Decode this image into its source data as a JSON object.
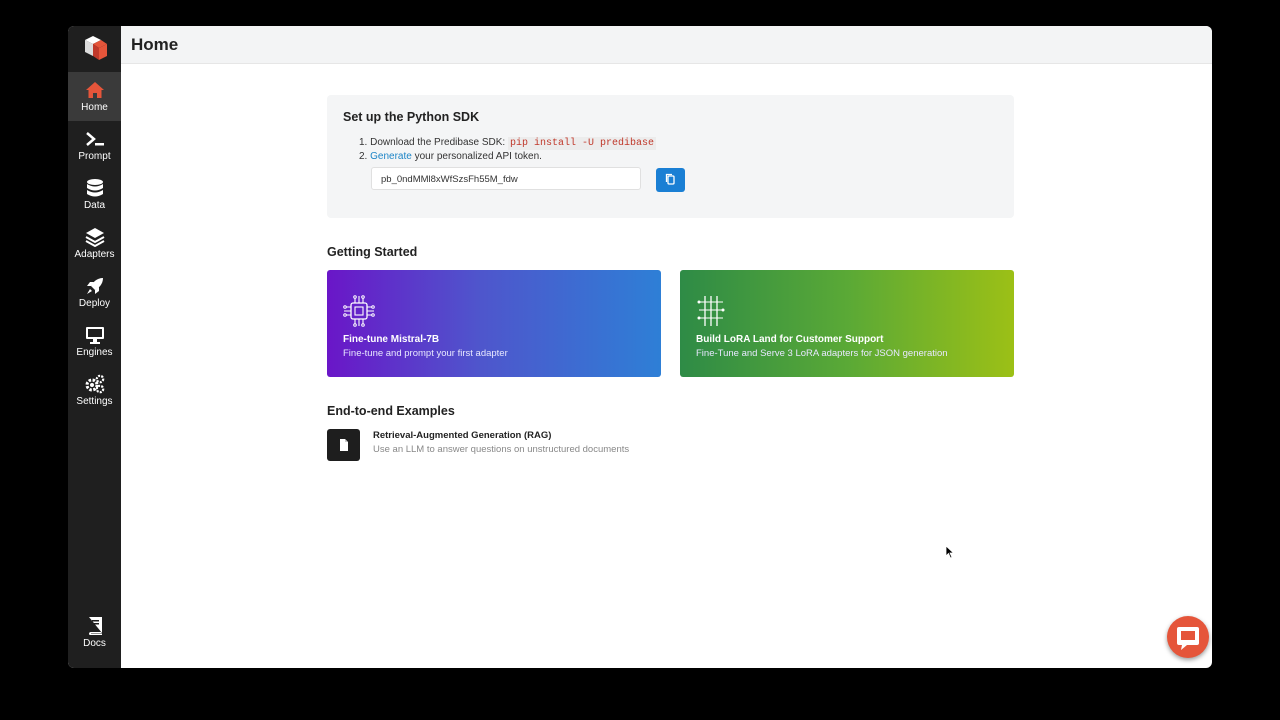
{
  "topbar": {
    "title": "Home"
  },
  "sidebar": {
    "items": [
      {
        "label": "Home",
        "icon": "home-icon",
        "active": true
      },
      {
        "label": "Prompt",
        "icon": "terminal-icon"
      },
      {
        "label": "Data",
        "icon": "database-icon"
      },
      {
        "label": "Adapters",
        "icon": "layers-icon"
      },
      {
        "label": "Deploy",
        "icon": "rocket-icon"
      },
      {
        "label": "Engines",
        "icon": "monitor-icon"
      },
      {
        "label": "Settings",
        "icon": "gears-icon"
      }
    ],
    "docs": {
      "label": "Docs",
      "icon": "book-icon"
    }
  },
  "sdk": {
    "title": "Set up the Python SDK",
    "step1_num": "1.",
    "step1_text": "Download the Predibase SDK:",
    "step1_code": "pip install -U predibase",
    "step2_num": "2.",
    "step2_link": "Generate",
    "step2_text": "your personalized API token.",
    "token": "pb_0ndMMl8xWfSzsFh55M_fdw"
  },
  "getting_started": {
    "title": "Getting Started",
    "cards": [
      {
        "title": "Fine-tune Mistral-7B",
        "desc": "Fine-tune and prompt your first adapter"
      },
      {
        "title": "Build LoRA Land for Customer Support",
        "desc": "Fine-Tune and Serve 3 LoRA adapters for JSON generation"
      }
    ]
  },
  "examples": {
    "title": "End-to-end Examples",
    "items": [
      {
        "title": "Retrieval-Augmented Generation (RAG)",
        "desc": "Use an LLM to answer questions on unstructured documents"
      }
    ]
  },
  "colors": {
    "accent": "#e5553a",
    "primary": "#1a7fd4",
    "sidebar": "#1f1f1f"
  }
}
